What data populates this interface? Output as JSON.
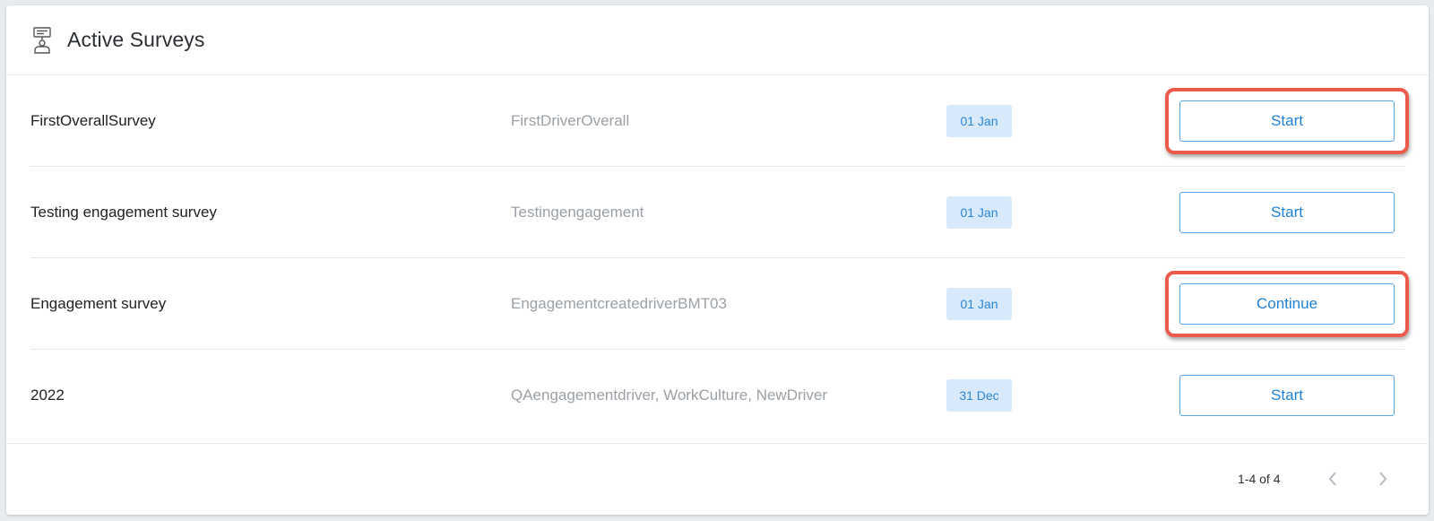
{
  "header": {
    "title": "Active Surveys",
    "icon": "survey-presenter-icon"
  },
  "surveys": [
    {
      "name": "FirstOverallSurvey",
      "drivers": "FirstDriverOverall",
      "date": "01 Jan",
      "action": "Start",
      "highlighted": true
    },
    {
      "name": "Testing engagement survey",
      "drivers": "Testingengagement",
      "date": "01 Jan",
      "action": "Start",
      "highlighted": false
    },
    {
      "name": "Engagement survey",
      "drivers": "EngagementcreatedriverBMT03",
      "date": "01 Jan",
      "action": "Continue",
      "highlighted": true
    },
    {
      "name": "2022",
      "drivers": "QAengagementdriver, WorkCulture, NewDriver",
      "date": "31 Dec",
      "action": "Start",
      "highlighted": false
    }
  ],
  "pagination": {
    "range_text": "1-4 of 4",
    "prev_icon": "chevron-left-icon",
    "next_icon": "chevron-right-icon"
  },
  "colors": {
    "highlight": "#ec5a4b",
    "accent": "#1f80d5",
    "badge_bg": "#d7e9fb"
  }
}
